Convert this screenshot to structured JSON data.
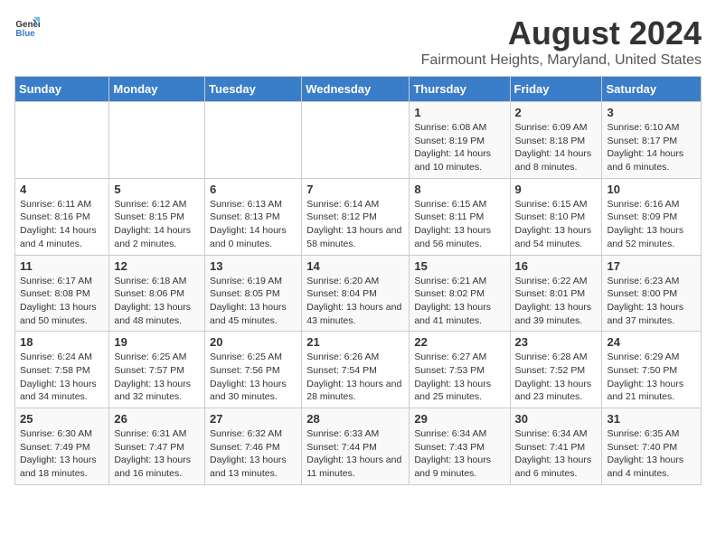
{
  "logo": {
    "line1": "General",
    "line2": "Blue"
  },
  "title": "August 2024",
  "subtitle": "Fairmount Heights, Maryland, United States",
  "days_header": [
    "Sunday",
    "Monday",
    "Tuesday",
    "Wednesday",
    "Thursday",
    "Friday",
    "Saturday"
  ],
  "weeks": [
    [
      {
        "day": "",
        "sunrise": "",
        "sunset": "",
        "daylight": ""
      },
      {
        "day": "",
        "sunrise": "",
        "sunset": "",
        "daylight": ""
      },
      {
        "day": "",
        "sunrise": "",
        "sunset": "",
        "daylight": ""
      },
      {
        "day": "",
        "sunrise": "",
        "sunset": "",
        "daylight": ""
      },
      {
        "day": "1",
        "sunrise": "Sunrise: 6:08 AM",
        "sunset": "Sunset: 8:19 PM",
        "daylight": "Daylight: 14 hours and 10 minutes."
      },
      {
        "day": "2",
        "sunrise": "Sunrise: 6:09 AM",
        "sunset": "Sunset: 8:18 PM",
        "daylight": "Daylight: 14 hours and 8 minutes."
      },
      {
        "day": "3",
        "sunrise": "Sunrise: 6:10 AM",
        "sunset": "Sunset: 8:17 PM",
        "daylight": "Daylight: 14 hours and 6 minutes."
      }
    ],
    [
      {
        "day": "4",
        "sunrise": "Sunrise: 6:11 AM",
        "sunset": "Sunset: 8:16 PM",
        "daylight": "Daylight: 14 hours and 4 minutes."
      },
      {
        "day": "5",
        "sunrise": "Sunrise: 6:12 AM",
        "sunset": "Sunset: 8:15 PM",
        "daylight": "Daylight: 14 hours and 2 minutes."
      },
      {
        "day": "6",
        "sunrise": "Sunrise: 6:13 AM",
        "sunset": "Sunset: 8:13 PM",
        "daylight": "Daylight: 14 hours and 0 minutes."
      },
      {
        "day": "7",
        "sunrise": "Sunrise: 6:14 AM",
        "sunset": "Sunset: 8:12 PM",
        "daylight": "Daylight: 13 hours and 58 minutes."
      },
      {
        "day": "8",
        "sunrise": "Sunrise: 6:15 AM",
        "sunset": "Sunset: 8:11 PM",
        "daylight": "Daylight: 13 hours and 56 minutes."
      },
      {
        "day": "9",
        "sunrise": "Sunrise: 6:15 AM",
        "sunset": "Sunset: 8:10 PM",
        "daylight": "Daylight: 13 hours and 54 minutes."
      },
      {
        "day": "10",
        "sunrise": "Sunrise: 6:16 AM",
        "sunset": "Sunset: 8:09 PM",
        "daylight": "Daylight: 13 hours and 52 minutes."
      }
    ],
    [
      {
        "day": "11",
        "sunrise": "Sunrise: 6:17 AM",
        "sunset": "Sunset: 8:08 PM",
        "daylight": "Daylight: 13 hours and 50 minutes."
      },
      {
        "day": "12",
        "sunrise": "Sunrise: 6:18 AM",
        "sunset": "Sunset: 8:06 PM",
        "daylight": "Daylight: 13 hours and 48 minutes."
      },
      {
        "day": "13",
        "sunrise": "Sunrise: 6:19 AM",
        "sunset": "Sunset: 8:05 PM",
        "daylight": "Daylight: 13 hours and 45 minutes."
      },
      {
        "day": "14",
        "sunrise": "Sunrise: 6:20 AM",
        "sunset": "Sunset: 8:04 PM",
        "daylight": "Daylight: 13 hours and 43 minutes."
      },
      {
        "day": "15",
        "sunrise": "Sunrise: 6:21 AM",
        "sunset": "Sunset: 8:02 PM",
        "daylight": "Daylight: 13 hours and 41 minutes."
      },
      {
        "day": "16",
        "sunrise": "Sunrise: 6:22 AM",
        "sunset": "Sunset: 8:01 PM",
        "daylight": "Daylight: 13 hours and 39 minutes."
      },
      {
        "day": "17",
        "sunrise": "Sunrise: 6:23 AM",
        "sunset": "Sunset: 8:00 PM",
        "daylight": "Daylight: 13 hours and 37 minutes."
      }
    ],
    [
      {
        "day": "18",
        "sunrise": "Sunrise: 6:24 AM",
        "sunset": "Sunset: 7:58 PM",
        "daylight": "Daylight: 13 hours and 34 minutes."
      },
      {
        "day": "19",
        "sunrise": "Sunrise: 6:25 AM",
        "sunset": "Sunset: 7:57 PM",
        "daylight": "Daylight: 13 hours and 32 minutes."
      },
      {
        "day": "20",
        "sunrise": "Sunrise: 6:25 AM",
        "sunset": "Sunset: 7:56 PM",
        "daylight": "Daylight: 13 hours and 30 minutes."
      },
      {
        "day": "21",
        "sunrise": "Sunrise: 6:26 AM",
        "sunset": "Sunset: 7:54 PM",
        "daylight": "Daylight: 13 hours and 28 minutes."
      },
      {
        "day": "22",
        "sunrise": "Sunrise: 6:27 AM",
        "sunset": "Sunset: 7:53 PM",
        "daylight": "Daylight: 13 hours and 25 minutes."
      },
      {
        "day": "23",
        "sunrise": "Sunrise: 6:28 AM",
        "sunset": "Sunset: 7:52 PM",
        "daylight": "Daylight: 13 hours and 23 minutes."
      },
      {
        "day": "24",
        "sunrise": "Sunrise: 6:29 AM",
        "sunset": "Sunset: 7:50 PM",
        "daylight": "Daylight: 13 hours and 21 minutes."
      }
    ],
    [
      {
        "day": "25",
        "sunrise": "Sunrise: 6:30 AM",
        "sunset": "Sunset: 7:49 PM",
        "daylight": "Daylight: 13 hours and 18 minutes."
      },
      {
        "day": "26",
        "sunrise": "Sunrise: 6:31 AM",
        "sunset": "Sunset: 7:47 PM",
        "daylight": "Daylight: 13 hours and 16 minutes."
      },
      {
        "day": "27",
        "sunrise": "Sunrise: 6:32 AM",
        "sunset": "Sunset: 7:46 PM",
        "daylight": "Daylight: 13 hours and 13 minutes."
      },
      {
        "day": "28",
        "sunrise": "Sunrise: 6:33 AM",
        "sunset": "Sunset: 7:44 PM",
        "daylight": "Daylight: 13 hours and 11 minutes."
      },
      {
        "day": "29",
        "sunrise": "Sunrise: 6:34 AM",
        "sunset": "Sunset: 7:43 PM",
        "daylight": "Daylight: 13 hours and 9 minutes."
      },
      {
        "day": "30",
        "sunrise": "Sunrise: 6:34 AM",
        "sunset": "Sunset: 7:41 PM",
        "daylight": "Daylight: 13 hours and 6 minutes."
      },
      {
        "day": "31",
        "sunrise": "Sunrise: 6:35 AM",
        "sunset": "Sunset: 7:40 PM",
        "daylight": "Daylight: 13 hours and 4 minutes."
      }
    ]
  ]
}
